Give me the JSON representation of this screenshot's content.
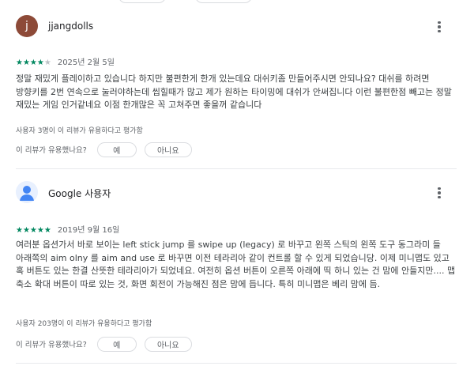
{
  "reviews": [
    {
      "author": "jjangdolls",
      "avatar_letter": "j",
      "avatar_color": "#8d4a38",
      "rating": 4,
      "stars_filled": "★★★★",
      "stars_empty": "★",
      "date": "2025년 2월 5일",
      "text": "정말 재밌게 플레이하고 있습니다 하지만 불편한게 한개 있는데요 대쉬키좀 만들어주시면 안되나요? 대쉬를 하려면 방향키를 2번 연속으로 눌러야하는데 씹힐때가 많고 제가 원하는 타이밍에 대쉬가 안써집니다 이런 불편한점 빼고는 정말 재밌는 게임 인거같네요 이점 한개많은 꼭 고쳐주면 좋을꺼 같습니다",
      "helpful_count": "사용자 3명이 이 리뷰가 유용하다고 평가함",
      "helpful_question": "이 리뷰가 유용했나요?",
      "yes_label": "예",
      "no_label": "아니요"
    },
    {
      "author": "Google 사용자",
      "avatar_type": "default-person",
      "rating": 5,
      "stars_filled": "★★★★★",
      "stars_empty": "",
      "date": "2019년 9월 16일",
      "text": "여러분 옵션가서 바로 보이는 left stick jump 를 swipe up (legacy) 로 바꾸고 왼쪽 스틱의 왼쪽 도구 동그라미 들 아래쪽의 aim olny 를 aim and use 로 바꾸면 이전 테라리아 같이 컨트롤 할 수 있게 되었습니당. 이제 미니맵도 있고 혹 버튼도 있는 한결 산뜻한 테라리아가 되었네요. 여전히 옵션 버튼이 오른쪽 아래에 띡 하니 있는 건 맘에 안들지만.... 맵 축소 확대 버튼이 따로 있는 것, 화면 회전이 가능해진 점은 맘에 듭니다. 특히 미니맵은 베리 맘에 듬.",
      "helpful_count": "사용자 203명이 이 리뷰가 유용하다고 평가함",
      "helpful_question": "이 리뷰가 유용했나요?",
      "yes_label": "예",
      "no_label": "아니요"
    }
  ],
  "colors": {
    "star": "#01875f",
    "star_empty": "#bdc1c6",
    "text": "#3c4043",
    "secondary": "#5f6368",
    "divider": "#e8eaed"
  },
  "icons": [
    "more-vert-icon",
    "person-icon"
  ]
}
